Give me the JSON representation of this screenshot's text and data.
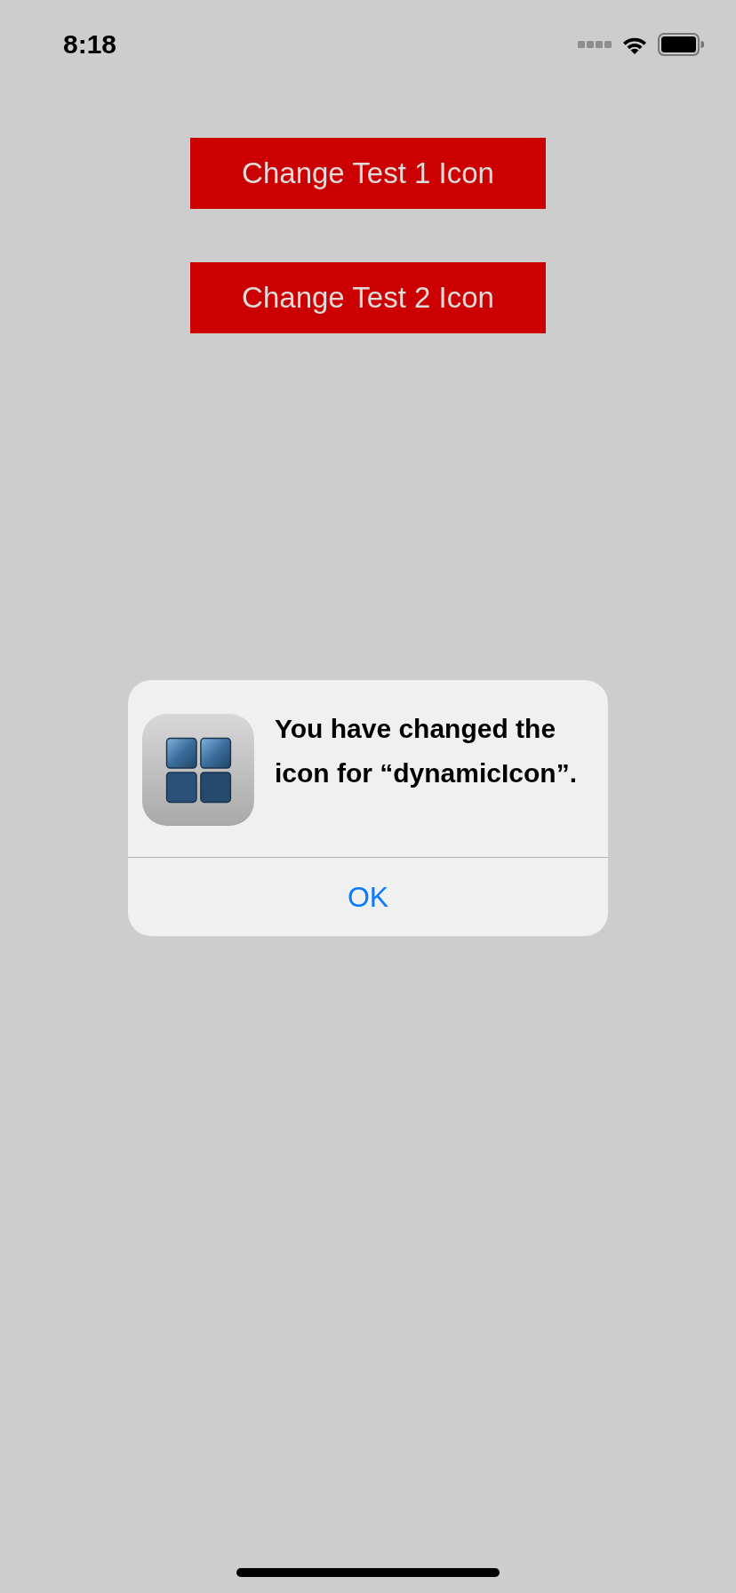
{
  "status_bar": {
    "time": "8:18"
  },
  "buttons": [
    {
      "label": "Change Test 1 Icon"
    },
    {
      "label": "Change Test 2 Icon"
    }
  ],
  "alert": {
    "message": "You have changed the icon for “dynamicIcon”.",
    "actions": [
      {
        "label": "OK"
      }
    ]
  }
}
